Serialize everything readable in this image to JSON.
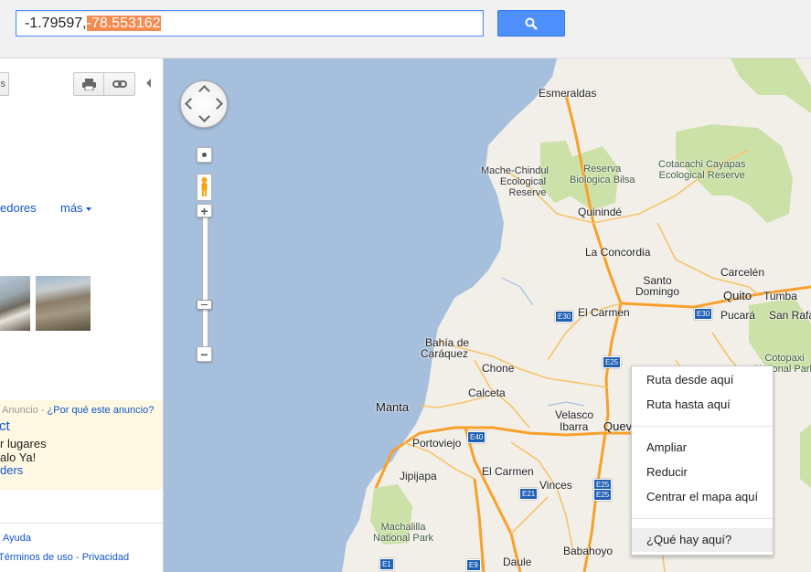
{
  "search": {
    "value_prefix": "-1.79597,",
    "value_selected": "-78.553162"
  },
  "panel": {
    "left_button_fragment": "s",
    "nav_links": [
      "edores",
      "más"
    ],
    "ad": {
      "label": "Anuncio",
      "why": "¿Por qué este anuncio?",
      "title": "ct",
      "line1": "r lugares",
      "line2": "alo Ya!",
      "link": "ders"
    },
    "footer": {
      "help": "Ayuda",
      "terms": "Términos de uso",
      "privacy": "Privacidad"
    }
  },
  "map": {
    "places": [
      "Esmeraldas",
      "Mache-Chindul",
      "Ecological",
      "Reserve",
      "Reserva",
      "Biologica Bilsa",
      "Cotacachi Cayapas",
      "Ecological Reserve",
      "Quinindé",
      "La Concordia",
      "Santo",
      "Domingo",
      "Carcelén",
      "Quito",
      "Tumba",
      "Pucará",
      "San Rafa",
      "El Carmen",
      "Bahía de",
      "Caráquez",
      "Chone",
      "Calceta",
      "Manta",
      "Portoviejo",
      "Velasco",
      "Ibarra",
      "Quev",
      "Jipijapa",
      "El Carmen",
      "Vinces",
      "Machalilla",
      "National Park",
      "Daule",
      "Babahoyo",
      "Cotopaxi",
      "National Park"
    ],
    "shields": [
      "E30",
      "E30",
      "E25",
      "E40",
      "E25",
      "E21",
      "E25",
      "E1",
      "E9"
    ]
  },
  "context_menu": {
    "items": [
      "Ruta desde aquí",
      "Ruta hasta aquí",
      "Ampliar",
      "Reducir",
      "Centrar el mapa aquí",
      "¿Qué hay aquí?"
    ]
  },
  "colors": {
    "water": "#a5bfdd",
    "land": "#f2efe9",
    "road": "#f6b84e",
    "highway": "#f8a02b",
    "park": "#cbe1a8",
    "accent": "#4d90fe"
  }
}
